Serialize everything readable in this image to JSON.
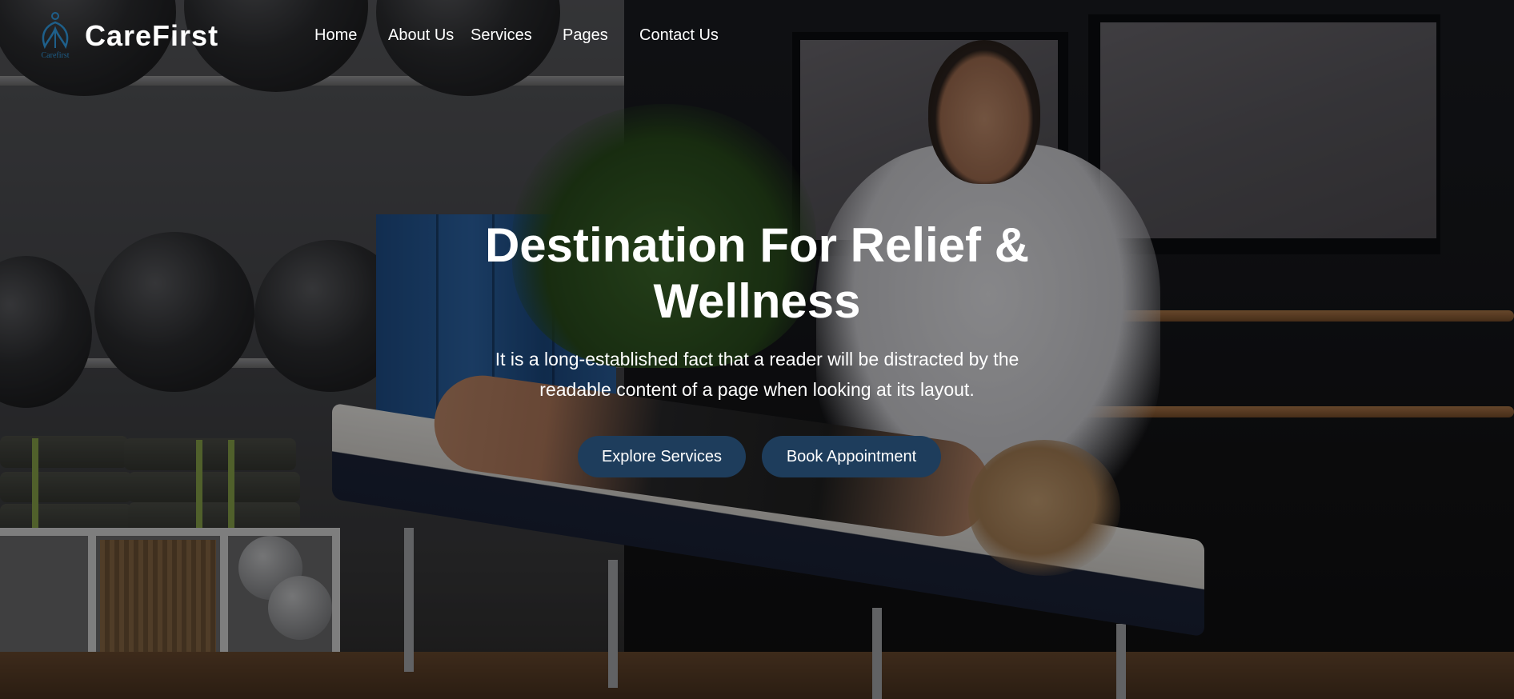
{
  "brand": {
    "name": "CareFirst",
    "logo_caption": "Carefirst",
    "logo_icon": "carefirst-logo-icon",
    "color": "#1e5f8a"
  },
  "nav": {
    "items": [
      {
        "label": "Home"
      },
      {
        "label": "About Us"
      },
      {
        "label": "Services"
      },
      {
        "label": "Pages"
      },
      {
        "label": "Contact Us"
      }
    ]
  },
  "hero": {
    "title_line1": "Destination For Relief &",
    "title_line2": "Wellness",
    "subtitle_line1": "It is a long-established fact that a reader will be distracted by the",
    "subtitle_line2": "readable content of a page when looking at its layout.",
    "background": "massage-therapy-room-photo",
    "primary_button": "Explore Services",
    "secondary_button": "Book Appointment",
    "button_color": "#1e3d5c"
  }
}
